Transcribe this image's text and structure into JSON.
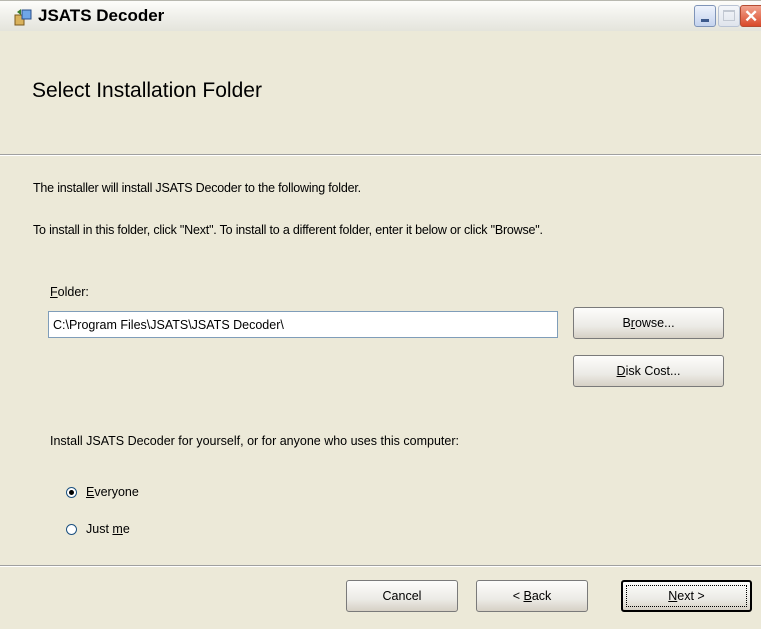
{
  "window": {
    "title": "JSATS Decoder",
    "minimize": "minimize",
    "maximize": "maximize",
    "close": "close"
  },
  "banner": {
    "title": "Select Installation Folder"
  },
  "body": {
    "line1": "The installer will install JSATS Decoder to the following folder.",
    "line2": "To install in this folder, click \"Next\". To install to a different folder, enter it below or click \"Browse\"."
  },
  "folder": {
    "label_mnemonic": "F",
    "label_rest": "older:",
    "value": "C:\\Program Files\\JSATS\\JSATS Decoder\\"
  },
  "buttons": {
    "browse_pre": "B",
    "browse_mn": "r",
    "browse_post": "owse...",
    "diskcost_mn": "D",
    "diskcost_post": "isk Cost...",
    "cancel": "Cancel",
    "back_pre": "< ",
    "back_mn": "B",
    "back_post": "ack",
    "next_mn": "N",
    "next_post": "ext >"
  },
  "install_for": {
    "prompt": "Install JSATS Decoder for yourself, or for anyone who uses this computer:",
    "options": [
      {
        "mn": "E",
        "rest": "veryone",
        "selected": true
      },
      {
        "pre": "Just ",
        "mn": "m",
        "rest": "e",
        "selected": false
      }
    ]
  },
  "colors": {
    "face": "#ece9d8",
    "close_button": "#d9492a",
    "input_border": "#7f9db9"
  },
  "icons": [
    "installer-app-icon",
    "minimize-icon",
    "maximize-icon",
    "close-icon"
  ]
}
